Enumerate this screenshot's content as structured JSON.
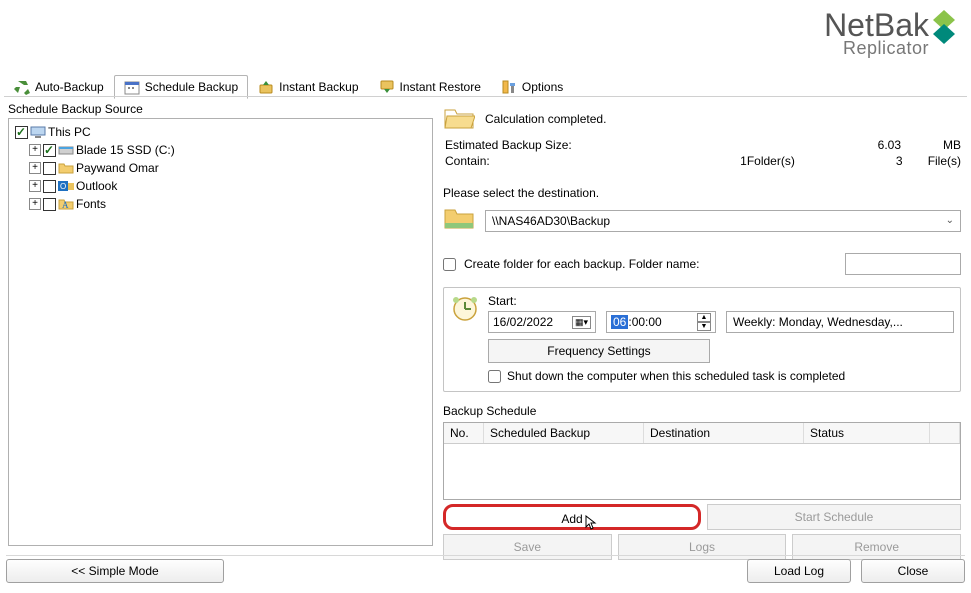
{
  "app": {
    "name_bold": "NetBak",
    "name_sub": "Replicator"
  },
  "tabs": {
    "auto": "Auto-Backup",
    "schedule": "Schedule Backup",
    "instant_backup": "Instant Backup",
    "instant_restore": "Instant Restore",
    "options": "Options"
  },
  "source": {
    "title": "Schedule Backup Source",
    "items": {
      "thispc": "This PC",
      "drive": "Blade 15 SSD (C:)",
      "user": "Paywand Omar",
      "outlook": "Outlook",
      "fonts": "Fonts"
    }
  },
  "calc": {
    "done": "Calculation completed.",
    "est_label": "Estimated Backup Size:",
    "est_val": "6.03",
    "est_unit": "MB",
    "contain_label": "Contain:",
    "folders_n": "1",
    "folders_u": "Folder(s)",
    "files_n": "3",
    "files_u": "File(s)"
  },
  "dest": {
    "prompt": "Please select the destination.",
    "path": "\\\\NAS46AD30\\Backup",
    "create_folder_label": "Create folder for each backup. Folder name:"
  },
  "sched": {
    "start_label": "Start:",
    "date": "16/02/2022",
    "time_h": "06",
    "time_rest": ":00:00",
    "freq_text": "Weekly: Monday, Wednesday,...",
    "freq_btn": "Frequency Settings",
    "shutdown": "Shut down the computer when this scheduled task is completed"
  },
  "table": {
    "title": "Backup Schedule",
    "h_no": "No.",
    "h_sb": "Scheduled Backup",
    "h_dest": "Destination",
    "h_status": "Status"
  },
  "buttons": {
    "add": "Add",
    "start": "Start Schedule",
    "save": "Save",
    "logs": "Logs",
    "remove": "Remove",
    "simple": "<<  Simple Mode",
    "loadlog": "Load Log",
    "close": "Close"
  }
}
